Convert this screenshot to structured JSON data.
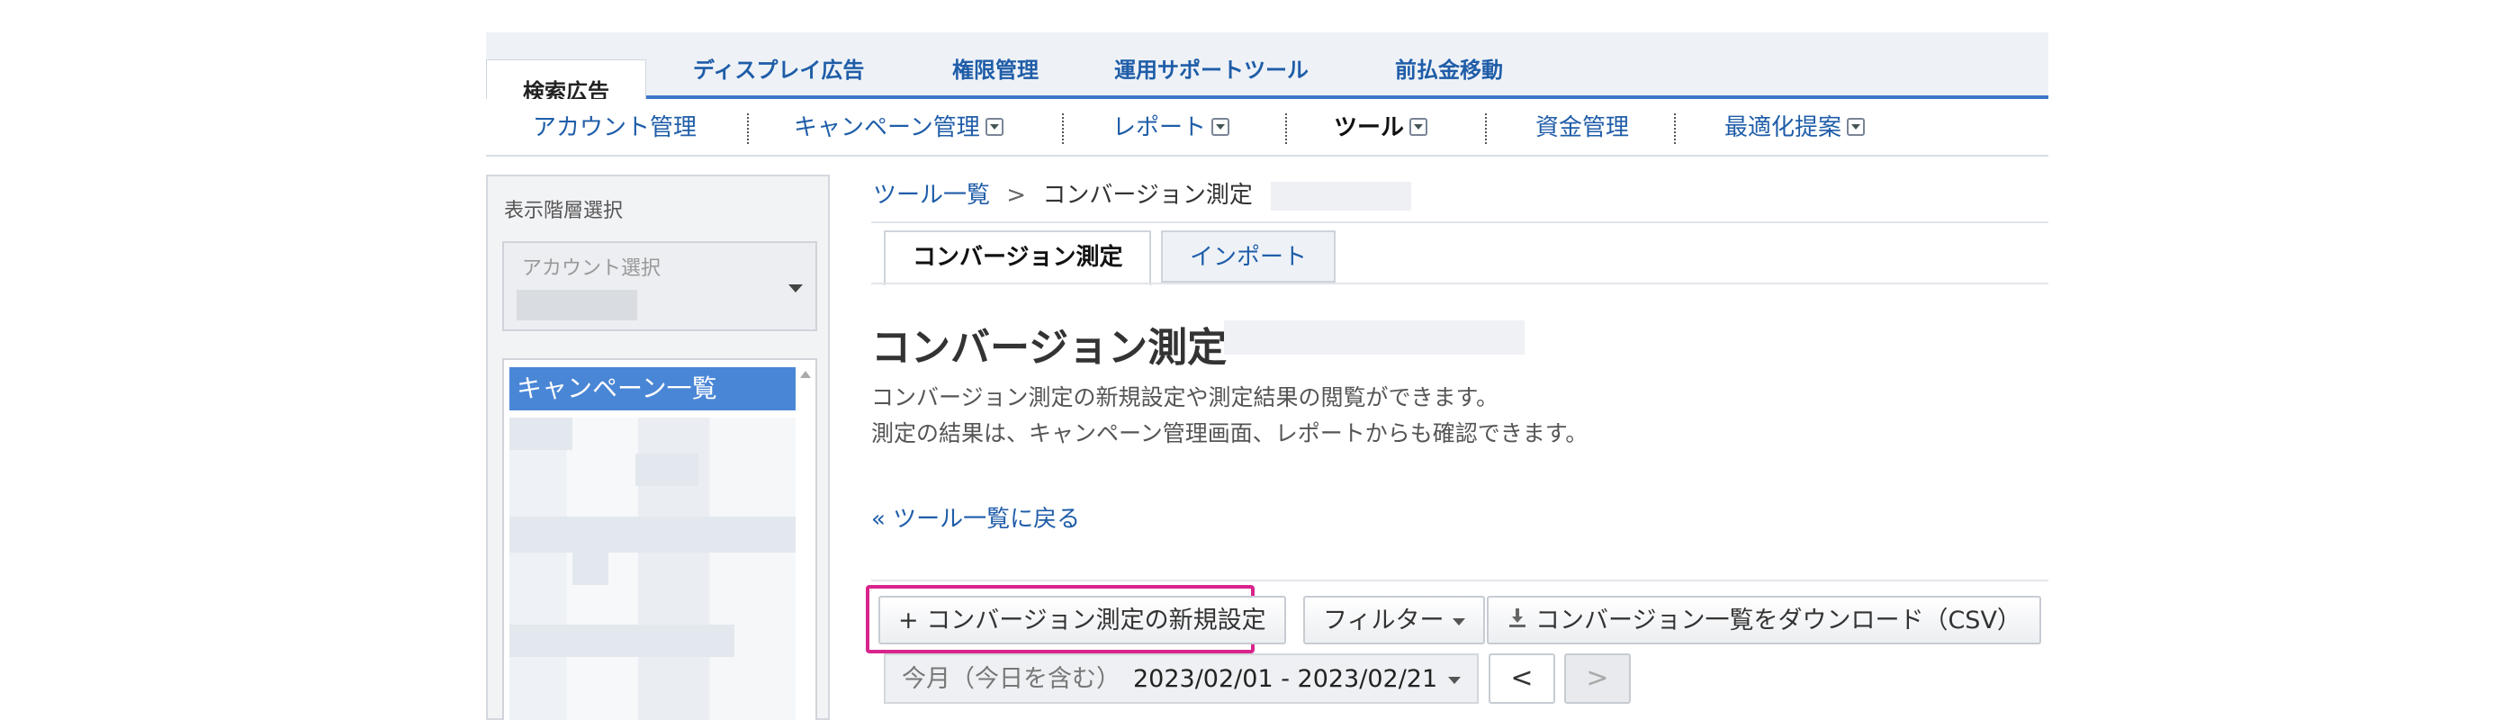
{
  "top_tabs": [
    {
      "label": "検索広告",
      "active": true
    },
    {
      "label": "ディスプレイ広告",
      "active": false
    },
    {
      "label": "権限管理",
      "active": false
    },
    {
      "label": "運用サポートツール",
      "active": false
    },
    {
      "label": "前払金移動",
      "active": false
    }
  ],
  "sub_nav": [
    {
      "label": "アカウント管理",
      "dropdown": false,
      "bold": false
    },
    {
      "label": "キャンペーン管理",
      "dropdown": true,
      "bold": false
    },
    {
      "label": "レポート",
      "dropdown": true,
      "bold": false
    },
    {
      "label": "ツール",
      "dropdown": true,
      "bold": true
    },
    {
      "label": "資金管理",
      "dropdown": false,
      "bold": false
    },
    {
      "label": "最適化提案",
      "dropdown": true,
      "bold": false
    }
  ],
  "sidebar": {
    "title": "表示階層選択",
    "account_select_label": "アカウント選択",
    "campaign_list_header": "キャンペーン一覧"
  },
  "breadcrumb": {
    "link": "ツール一覧",
    "separator": ">",
    "current": "コンバージョン測定"
  },
  "content_tabs": [
    {
      "label": "コンバージョン測定",
      "active": true
    },
    {
      "label": "インポート",
      "active": false
    }
  ],
  "page_title": "コンバージョン測定",
  "description": [
    "コンバージョン測定の新規設定や測定結果の閲覧ができます。",
    "測定の結果は、キャンペーン管理画面、レポートからも確認できます。"
  ],
  "back_link": "« ツール一覧に戻る",
  "toolbar": {
    "new_button": "+ コンバージョン測定の新規設定",
    "filter_button": "フィルター",
    "download_button": "コンバージョン一覧をダウンロード（CSV）"
  },
  "date_range": {
    "preset": "今月（今日を含む）",
    "value": "2023/02/01 - 2023/02/21"
  },
  "pager": {
    "prev": "<",
    "next": ">"
  },
  "colors": {
    "accent": "#3b76c8",
    "link": "#1f5da8",
    "highlight": "#d9248c"
  }
}
